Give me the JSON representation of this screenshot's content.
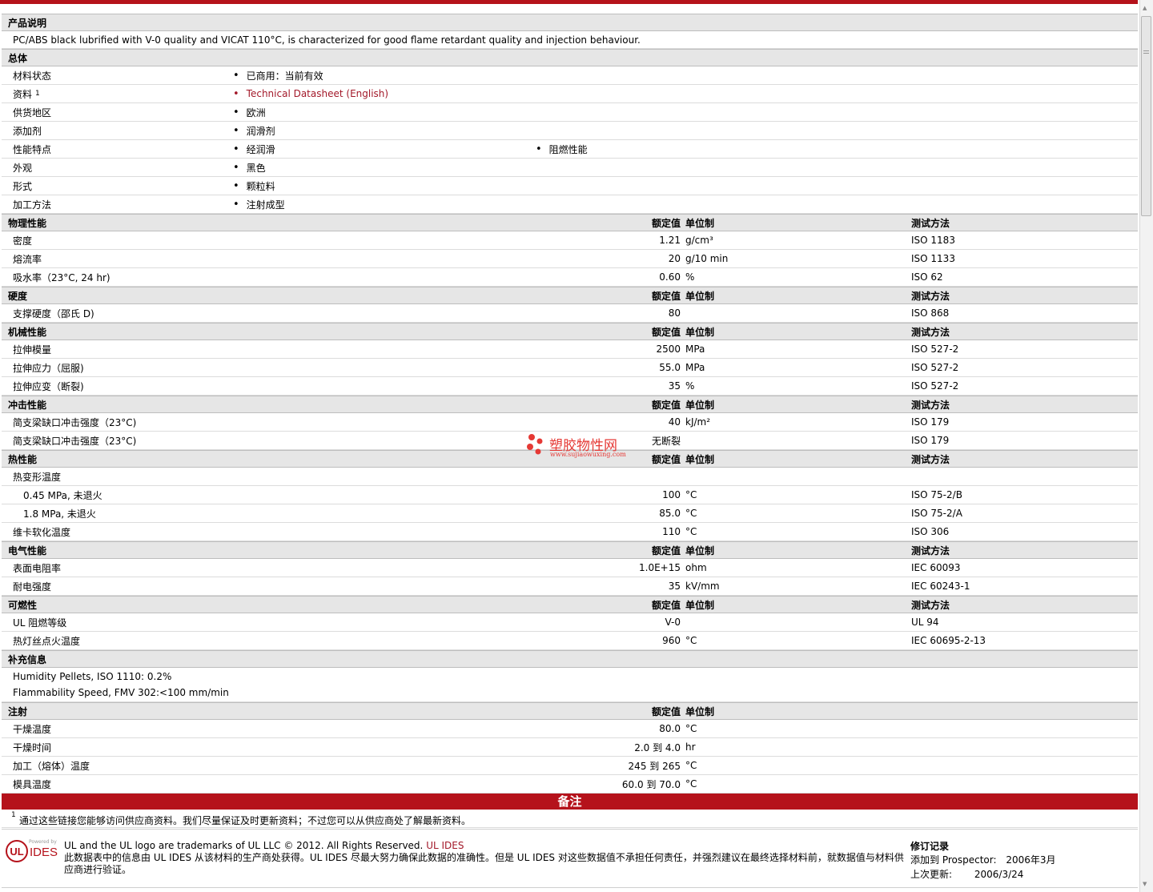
{
  "colors": {
    "accent": "#b5121b",
    "link": "#a3192a",
    "section_bg": "#e6e6e6"
  },
  "headers": {
    "value": "额定值",
    "unit": "单位制",
    "test": "测试方法"
  },
  "description": {
    "title": "产品说明",
    "text": "PC/ABS black lubrified with V-0 quality and VICAT 110°C, is characterized for good flame retardant quality and injection behaviour."
  },
  "general": {
    "title": "总体",
    "rows": [
      {
        "label": "材料状态",
        "v1": "已商用：当前有效",
        "v2": ""
      },
      {
        "label": "资料",
        "sup": "1",
        "v1": "Technical Datasheet (English)",
        "v2": ""
      },
      {
        "label": "供货地区",
        "v1": "欧洲",
        "v2": ""
      },
      {
        "label": "添加剂",
        "v1": "润滑剂",
        "v2": ""
      },
      {
        "label": "性能特点",
        "v1": "经润滑",
        "v2": "阻燃性能"
      },
      {
        "label": "外观",
        "v1": "黑色",
        "v2": ""
      },
      {
        "label": "形式",
        "v1": "颗粒料",
        "v2": ""
      },
      {
        "label": "加工方法",
        "v1": "注射成型",
        "v2": ""
      }
    ]
  },
  "physical": {
    "title": "物理性能",
    "rows": [
      {
        "label": "密度",
        "value": "1.21",
        "unit": "g/cm³",
        "test": "ISO 1183"
      },
      {
        "label": "熔流率",
        "value": "20",
        "unit": "g/10 min",
        "test": "ISO 1133"
      },
      {
        "label": "吸水率（23°C, 24 hr)",
        "value": "0.60",
        "unit": "%",
        "test": "ISO 62"
      }
    ]
  },
  "hardness": {
    "title": "硬度",
    "rows": [
      {
        "label": "支撑硬度（邵氏 D)",
        "value": "80",
        "unit": "",
        "test": "ISO 868"
      }
    ]
  },
  "mechanical": {
    "title": "机械性能",
    "rows": [
      {
        "label": "拉伸模量",
        "value": "2500",
        "unit": "MPa",
        "test": "ISO 527-2"
      },
      {
        "label": "拉伸应力（屈服)",
        "value": "55.0",
        "unit": "MPa",
        "test": "ISO 527-2"
      },
      {
        "label": "拉伸应变（断裂)",
        "value": "35",
        "unit": "%",
        "test": "ISO 527-2"
      }
    ]
  },
  "impact": {
    "title": "冲击性能",
    "rows": [
      {
        "label": "简支梁缺口冲击强度（23°C)",
        "value": "40",
        "unit": "kJ/m²",
        "test": "ISO 179"
      },
      {
        "label": "简支梁缺口冲击强度（23°C)",
        "value": "无断裂",
        "unit": "",
        "test": "ISO 179"
      }
    ]
  },
  "thermal": {
    "title": "热性能",
    "sub_label": "热变形温度",
    "rows": [
      {
        "label": "0.45 MPa, 未退火",
        "value": "100",
        "unit": "°C",
        "test": "ISO 75-2/B"
      },
      {
        "label": "1.8 MPa, 未退火",
        "value": "85.0",
        "unit": "°C",
        "test": "ISO 75-2/A"
      }
    ],
    "vicat": {
      "label": "维卡软化温度",
      "value": "110",
      "unit": "°C",
      "test": "ISO 306"
    }
  },
  "electrical": {
    "title": "电气性能",
    "rows": [
      {
        "label": "表面电阻率",
        "value": "1.0E+15",
        "unit": "ohm",
        "test": "IEC 60093"
      },
      {
        "label": "耐电强度",
        "value": "35",
        "unit": "kV/mm",
        "test": "IEC 60243-1"
      }
    ]
  },
  "flammability": {
    "title": "可燃性",
    "rows": [
      {
        "label": "UL 阻燃等级",
        "value": "V-0",
        "unit": "",
        "test": "UL 94"
      },
      {
        "label": "热灯丝点火温度",
        "value": "960",
        "unit": "°C",
        "test": "IEC 60695-2-13"
      }
    ]
  },
  "supplemental": {
    "title": "补充信息",
    "lines": [
      "Humidity Pellets, ISO 1110: 0.2%",
      "Flammability Speed, FMV 302:<100 mm/min"
    ]
  },
  "injection": {
    "title": "注射",
    "rows": [
      {
        "label": "干燥温度",
        "value": "80.0",
        "unit": "°C"
      },
      {
        "label": "干燥时间",
        "value": "2.0 到  4.0",
        "unit": "hr"
      },
      {
        "label": "加工（熔体）温度",
        "value": "245 到  265",
        "unit": "°C"
      },
      {
        "label": "模具温度",
        "value": "60.0 到  70.0",
        "unit": "°C"
      }
    ]
  },
  "notes": {
    "title": "备注",
    "sup": "1",
    "text": "通过这些链接您能够访问供应商资料。我们尽量保证及时更新资料；不过您可以从供应商处了解最新资料。"
  },
  "footer": {
    "logo_ul": "UL",
    "logo_powered": "Powered by",
    "logo_ides": "IDES",
    "trademark": "UL and the UL logo are trademarks of UL LLC © 2012. All Rights Reserved.",
    "trademark_link": "UL IDES",
    "disclaimer": "此数据表中的信息由  UL IDES 从该材料的生产商处获得。UL IDES 尽最大努力确保此数据的准确性。但是  UL IDES 对这些数据值不承担任何责任，并强烈建议在最终选择材料前，就数据值与材料供应商进行验证。",
    "revision_title": "修订记录",
    "added_label": "添加到  Prospector:",
    "added_value": "2006年3月",
    "updated_label": "上次更新:",
    "updated_value": "2006/3/24"
  },
  "watermark": {
    "name": "塑胶物性网",
    "url": "www.sujiaowuxing.com"
  }
}
